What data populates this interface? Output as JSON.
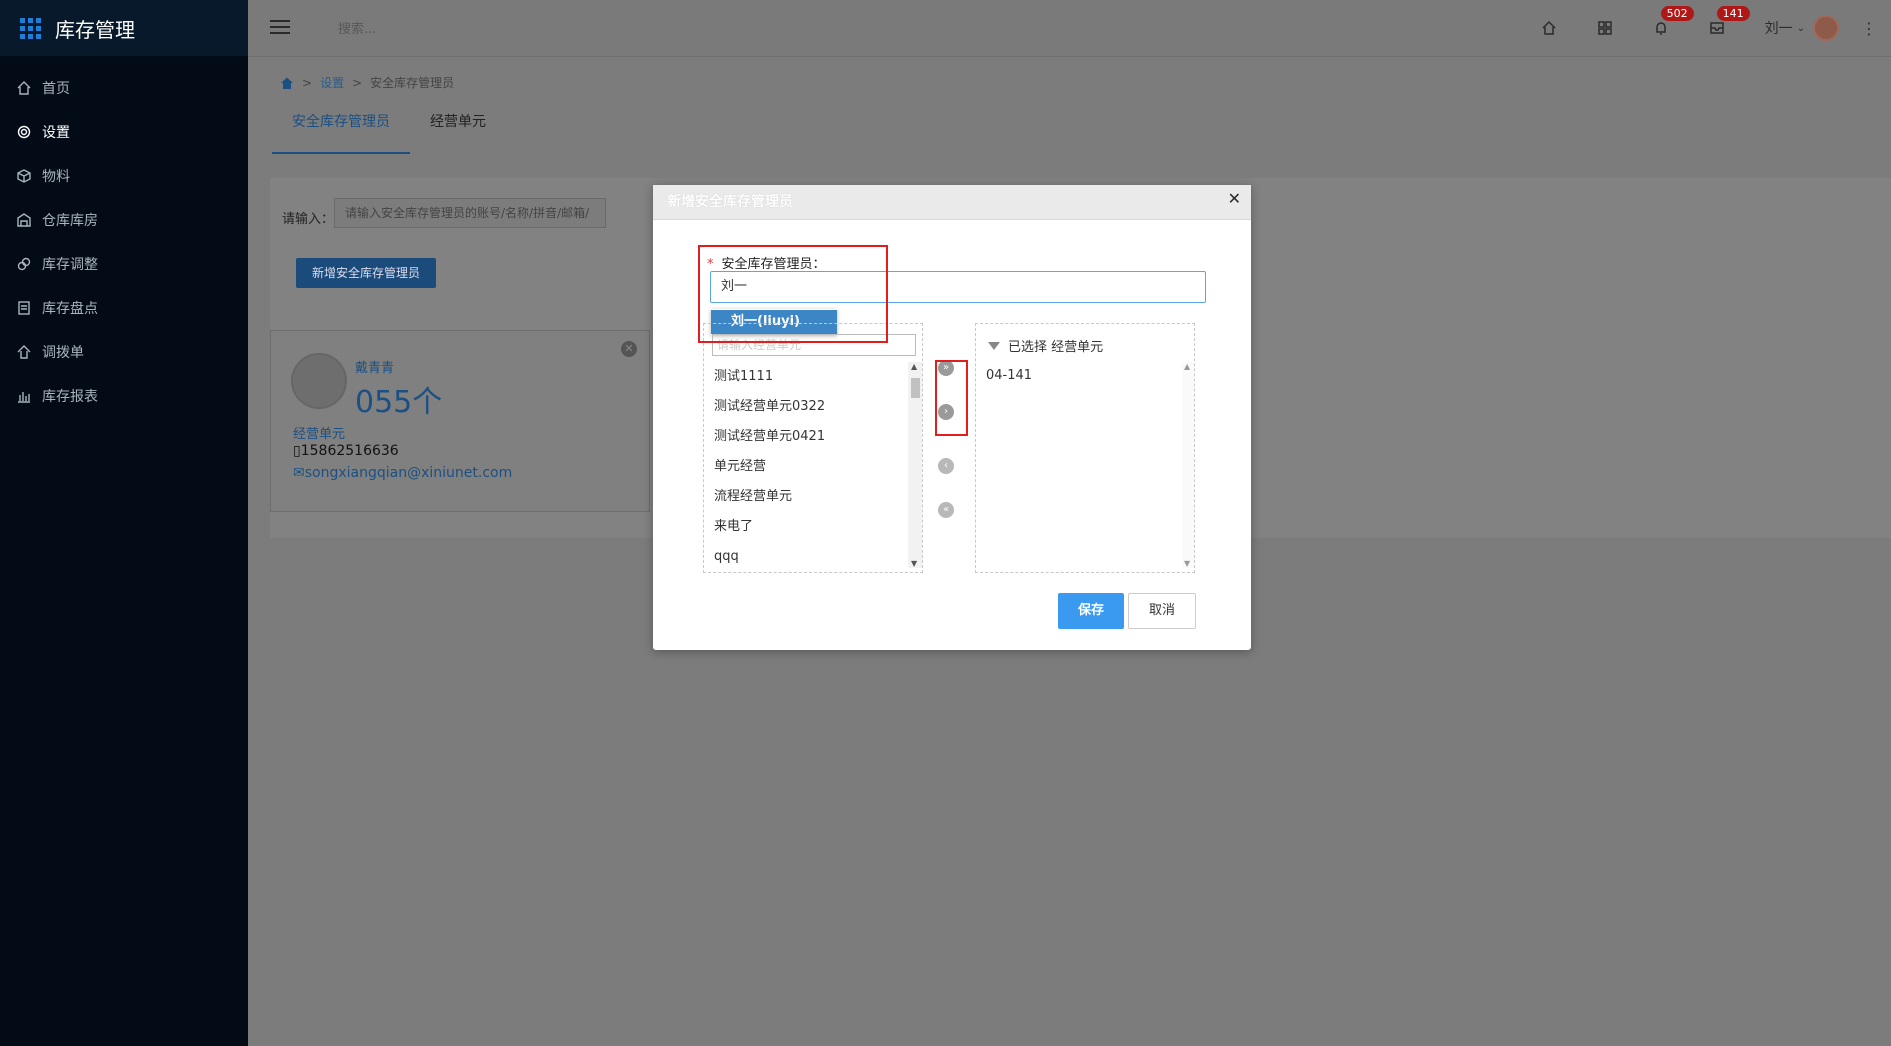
{
  "app": {
    "title": "库存管理"
  },
  "sidebar": {
    "items": [
      {
        "label": "首页",
        "icon": "home-icon"
      },
      {
        "label": "设置",
        "icon": "gear-icon"
      },
      {
        "label": "物料",
        "icon": "box-icon"
      },
      {
        "label": "仓库库房",
        "icon": "warehouse-icon"
      },
      {
        "label": "库存调整",
        "icon": "adjust-icon"
      },
      {
        "label": "库存盘点",
        "icon": "inventory-check-icon"
      },
      {
        "label": "调拨单",
        "icon": "transfer-icon"
      },
      {
        "label": "库存报表",
        "icon": "bar-chart-icon"
      }
    ]
  },
  "topbar": {
    "search_placeholder": "搜索...",
    "badge_1": "502",
    "badge_2": "141",
    "user_name": "刘一"
  },
  "breadcrumb": {
    "level1": "设置",
    "level2": "安全库存管理员"
  },
  "tabs": [
    "安全库存管理员",
    "经营单元"
  ],
  "search_form": {
    "label": "请输入：",
    "placeholder": "请输入安全库存管理员的账号/名称/拼音/邮箱/",
    "add_button": "新增安全库存管理员"
  },
  "card": {
    "name": "戴青青",
    "count": "055个",
    "unit_label": "经营单元",
    "phone": "15862516636",
    "email": "songxiangqian@xiniunet.com"
  },
  "modal": {
    "title": "新增安全库存管理员",
    "field_label": "安全库存管理员：",
    "field_value": "刘一",
    "dropdown_option": "刘一(liuyi)",
    "filter_placeholder": "请输入经营单元",
    "available_items": [
      "测试1111",
      "测试经营单元0322",
      "测试经营单元0421",
      "单元经营",
      "流程经营单元",
      "来电了",
      "qqq"
    ],
    "selected_title": "已选择 经营单元",
    "selected_items": [
      "04-141"
    ],
    "save_label": "保存",
    "cancel_label": "取消"
  },
  "colors": {
    "accent": "#3a9af0",
    "highlight": "#e21d1d",
    "sidebar_bg": "#020b16"
  }
}
